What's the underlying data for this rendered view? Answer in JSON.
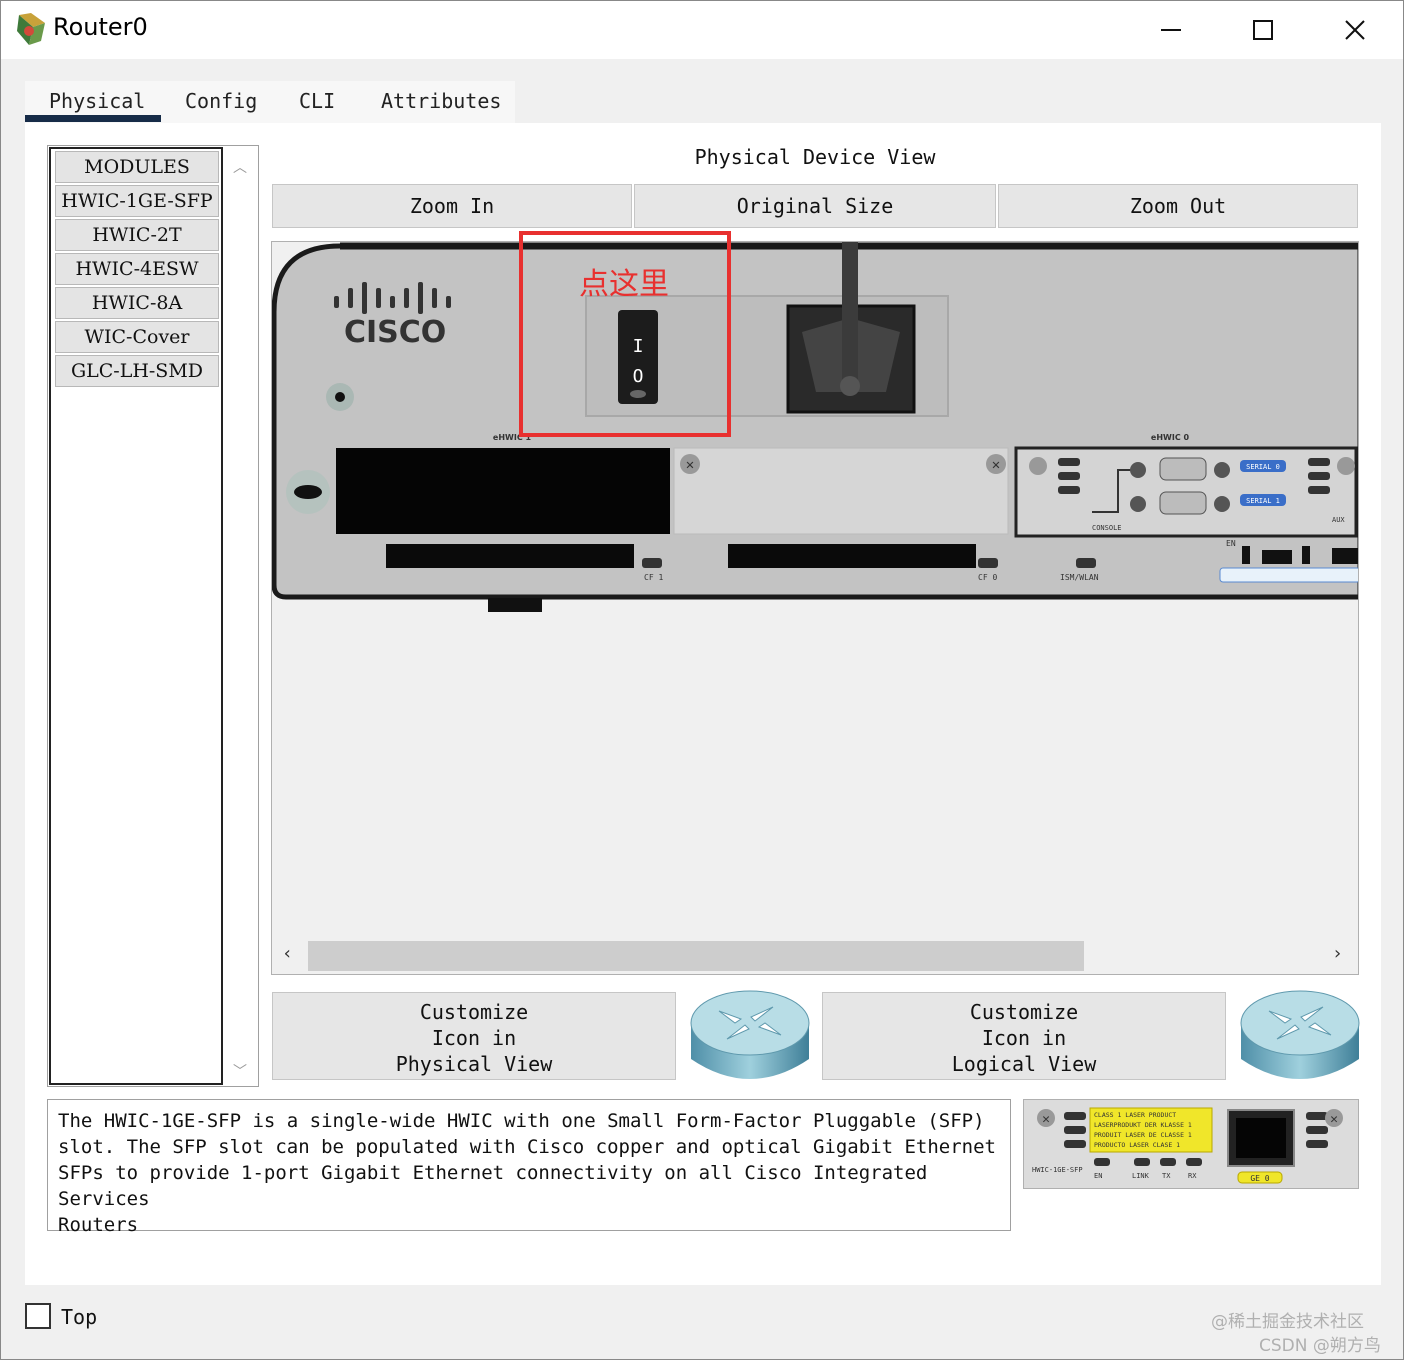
{
  "window": {
    "title": "Router0"
  },
  "tabs": [
    {
      "label": "Physical",
      "active": true
    },
    {
      "label": "Config"
    },
    {
      "label": "CLI"
    },
    {
      "label": "Attributes"
    }
  ],
  "modules": {
    "header": "MODULES",
    "items": [
      "HWIC-1GE-SFP",
      "HWIC-2T",
      "HWIC-4ESW",
      "HWIC-8A",
      "WIC-Cover",
      "GLC-LH-SMD"
    ]
  },
  "physical_view": {
    "title": "Physical Device View",
    "zoom_in": "Zoom In",
    "original_size": "Original Size",
    "zoom_out": "Zoom Out",
    "annotation": "点这里",
    "brand": "CISCO",
    "switch_on": "I",
    "switch_off": "O",
    "slot_labels": [
      "eHWIC 1",
      "eHWIC 0",
      "CF 1",
      "CF 0",
      "ISM/WLAN",
      "CONSOLE",
      "AUX",
      "EN"
    ],
    "serial_labels": [
      "SERIAL 0",
      "SERIAL 1"
    ]
  },
  "customize": {
    "physical": [
      "Customize",
      "Icon in",
      "Physical View"
    ],
    "logical": [
      "Customize",
      "Icon in",
      "Logical View"
    ]
  },
  "description": "The HWIC-1GE-SFP is a single-wide HWIC with one Small Form-Factor Pluggable (SFP)\nslot. The SFP slot can be populated with Cisco copper and optical Gigabit Ethernet\nSFPs to provide 1-port Gigabit Ethernet connectivity on all Cisco Integrated Services\nRouters",
  "module_preview": {
    "warning_lines": [
      "CLASS 1 LASER PRODUCT",
      "LASERPRODUKT DER KLASSE 1",
      "PRODUIT LASER DE CLASSE 1",
      "PRODUCTO LASER CLASE 1"
    ],
    "name": "HWIC-1GE-SFP",
    "leds": [
      "EN",
      "LINK",
      "TX",
      "RX"
    ],
    "port": "GE 0"
  },
  "footer": {
    "top_label": "Top"
  },
  "watermark": {
    "line1": "@稀土掘金技术社区",
    "line2": "CSDN @朔方鸟"
  },
  "colors": {
    "annotation": "#e8302f",
    "tab_underline": "#172c48"
  }
}
